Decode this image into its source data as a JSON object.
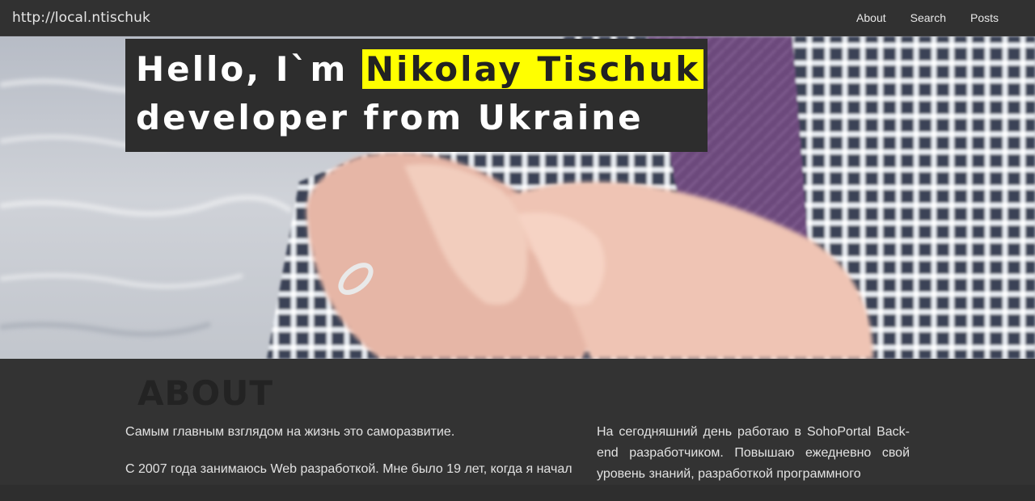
{
  "navbar": {
    "brand": "http://local.ntischuk",
    "links": [
      "About",
      "Search",
      "Posts"
    ]
  },
  "hero": {
    "line1_prefix": "Hello, I`m ",
    "line1_highlight": "Nikolay Tischuk",
    "line2": "developer from Ukraine",
    "highlight_color": "#ffff00"
  },
  "about": {
    "heading": "ABOUT",
    "left_paragraphs": [
      "Самым главным взглядом на жизнь это саморазвитие.",
      "С 2007 года занимаюсь Web разработкой. Мне было 19 лет, когда я начал"
    ],
    "right_paragraph": "На сегодняшний день работаю в SohoPortal Back-end разработчиком. Повышаю ежедневно свой уровень знаний, разработкой программного"
  },
  "colors": {
    "navbar_bg": "#313131",
    "section_bg": "#333333",
    "text": "#e2e2e2"
  }
}
